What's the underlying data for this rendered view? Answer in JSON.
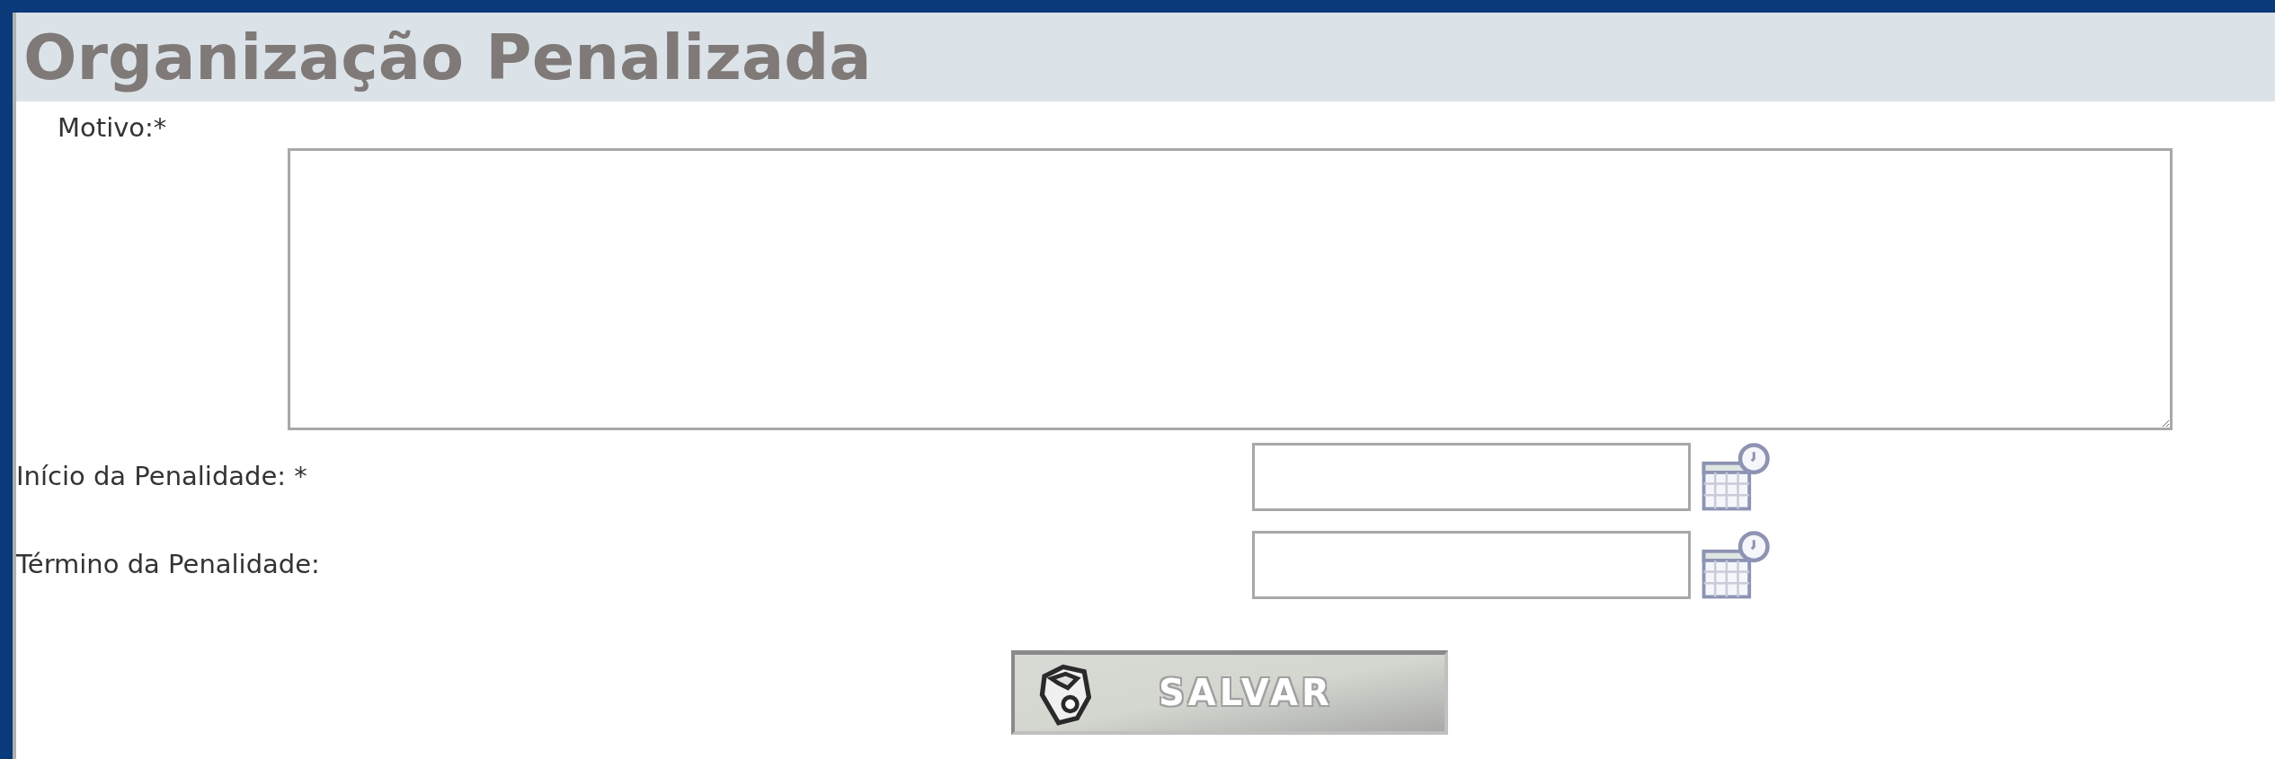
{
  "title": "Organização Penalizada",
  "reason": {
    "label": "Motivo:*"
  },
  "date_fields": [
    {
      "label": "Início da Penalidade: *"
    },
    {
      "label": "Término da Penalidade:"
    }
  ],
  "save_button": {
    "label": "SALVAR"
  }
}
